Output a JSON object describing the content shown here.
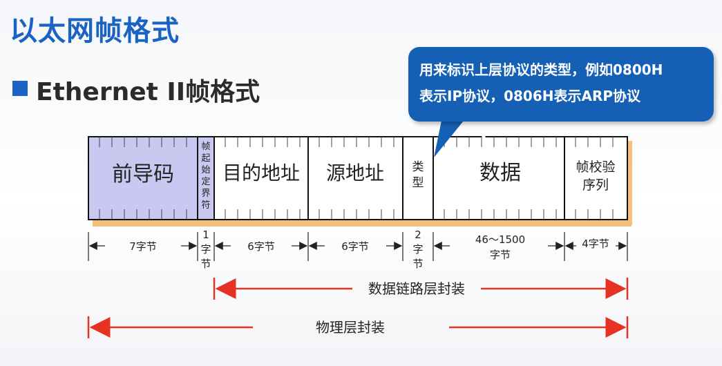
{
  "title": "以太网帧格式",
  "subtitle": "Ethernet II帧格式",
  "callout": {
    "line1": "用来标识上层协议的类型，例如0800H",
    "line2": "表示IP协议，0806H表示ARP协议"
  },
  "fields": [
    {
      "id": "preamble",
      "label": [
        "前导码"
      ],
      "size": [
        "7字节"
      ]
    },
    {
      "id": "sfd",
      "label": [
        "帧",
        "起",
        "始",
        "定",
        "界",
        "符"
      ],
      "size": [
        "1",
        "字",
        "节"
      ]
    },
    {
      "id": "dst",
      "label": [
        "目的地址"
      ],
      "size": [
        "6字节"
      ]
    },
    {
      "id": "src",
      "label": [
        "源地址"
      ],
      "size": [
        "6字节"
      ]
    },
    {
      "id": "type",
      "label": [
        "类",
        "型"
      ],
      "size": [
        "2",
        "字",
        "节"
      ]
    },
    {
      "id": "data",
      "label": [
        "数据"
      ],
      "size": [
        "46～1500",
        "字节"
      ]
    },
    {
      "id": "fcs",
      "label": [
        "帧校验",
        "序列"
      ],
      "size": [
        "4字节"
      ]
    }
  ],
  "spans": {
    "datalink": "数据链路层封装",
    "physical": "物理层封装"
  },
  "colors": {
    "title": "#1a63c2",
    "callout": "#1560b5",
    "preamble_fill": "#c8c8f0",
    "arrow_red": "#e53222",
    "shadow_orange": "#f7c07a"
  }
}
